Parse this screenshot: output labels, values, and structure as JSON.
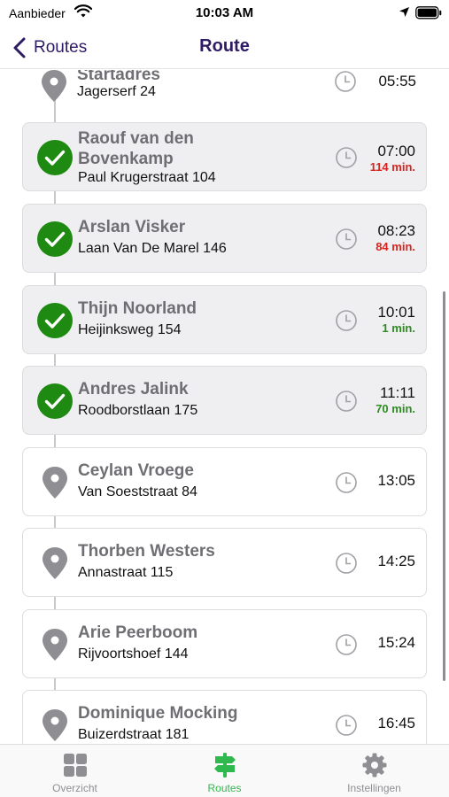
{
  "status_bar": {
    "carrier": "Aanbieder",
    "time": "10:03 AM"
  },
  "nav": {
    "back_label": "Routes",
    "title": "Route"
  },
  "colors": {
    "accent": "#2d1b63",
    "done_green": "#1e8a12",
    "late_red": "#d9231e",
    "early_green": "#2e8b22",
    "active_tab": "#2fb84e"
  },
  "start": {
    "name": "Startadres",
    "address": "Jagerserf 24",
    "time": "05:55",
    "icon": "map-pin-icon"
  },
  "stops": [
    {
      "name": "Raouf van den Bovenkamp",
      "address": "Paul Krugerstraat 104",
      "time": "07:00",
      "delay": "114 min.",
      "delay_type": "late",
      "status": "done"
    },
    {
      "name": "Arslan Visker",
      "address": "Laan Van De Marel 146",
      "time": "08:23",
      "delay": "84 min.",
      "delay_type": "late",
      "status": "done"
    },
    {
      "name": "Thijn Noorland",
      "address": "Heijinksweg 154",
      "time": "10:01",
      "delay": "1 min.",
      "delay_type": "early",
      "status": "done"
    },
    {
      "name": "Andres Jalink",
      "address": "Roodborstlaan 175",
      "time": "11:11",
      "delay": "70 min.",
      "delay_type": "early",
      "status": "done"
    },
    {
      "name": "Ceylan Vroege",
      "address": "Van Soeststraat 84",
      "time": "13:05",
      "status": "pending"
    },
    {
      "name": "Thorben Westers",
      "address": "Annastraat 115",
      "time": "14:25",
      "status": "pending"
    },
    {
      "name": "Arie Peerboom",
      "address": "Rijvoortshoef 144",
      "time": "15:24",
      "status": "pending"
    },
    {
      "name": "Dominique Mocking",
      "address": "Buizerdstraat 181",
      "time": "16:45",
      "status": "pending"
    }
  ],
  "tabs": [
    {
      "label": "Overzicht",
      "icon": "grid-icon",
      "active": false
    },
    {
      "label": "Routes",
      "icon": "signpost-icon",
      "active": true
    },
    {
      "label": "Instellingen",
      "icon": "gear-icon",
      "active": false
    }
  ]
}
